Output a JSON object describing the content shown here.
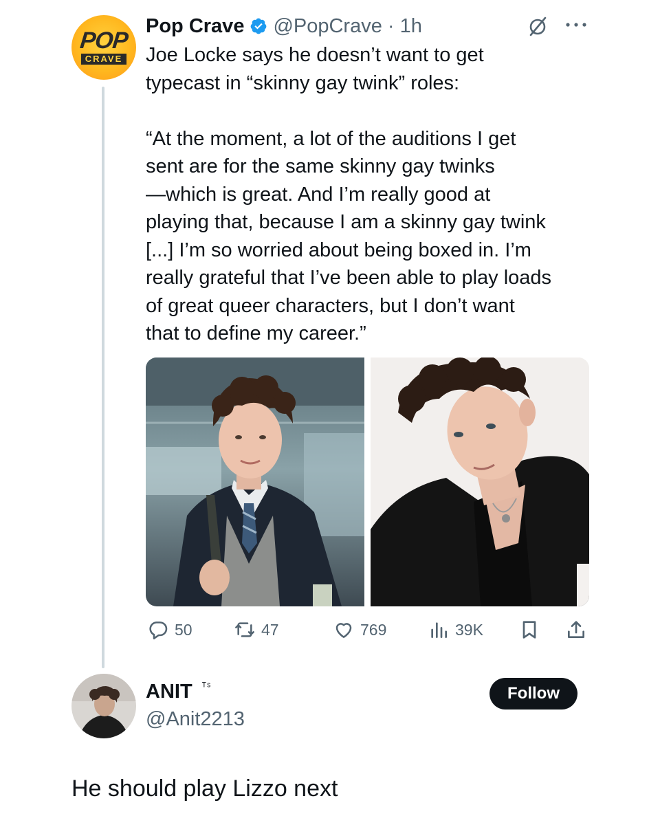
{
  "quoted_tweet": {
    "author_name": "Pop Crave",
    "handle_time": "@PopCrave · 1h",
    "avatar_logo": {
      "top": "POP",
      "bottom": "CRAVE"
    },
    "text": "Joe Locke says he doesn’t want to get\ntypecast in “skinny gay twink” roles:\n\n“At the moment, a lot of the auditions I get\nsent are for the same skinny gay twinks\n—which is great. And I’m really good at\nplaying that, because I am a skinny gay twink\n[...] I’m so worried about being boxed in. I’m\nreally grateful that I’ve been able to play loads\nof great queer characters, but I don’t want\nthat to define my career.”",
    "actions": {
      "replies": "50",
      "retweets": "47",
      "likes": "769",
      "views": "39K"
    },
    "icons": [
      "verified-badge-icon",
      "mute-icon",
      "more-icon",
      "reply-icon",
      "retweet-icon",
      "like-icon",
      "views-icon",
      "bookmark-icon",
      "share-icon"
    ]
  },
  "reply": {
    "author_name": "ANIT",
    "author_mark": "ᵀˢ",
    "handle": "@Anit2213",
    "follow_label": "Follow",
    "text": "He should play Lizzo next"
  },
  "colors": {
    "text": "#0f1419",
    "muted": "#536471",
    "verified": "#1d9bf0",
    "thread_line": "#cfd9de",
    "button_bg": "#0f1419"
  }
}
